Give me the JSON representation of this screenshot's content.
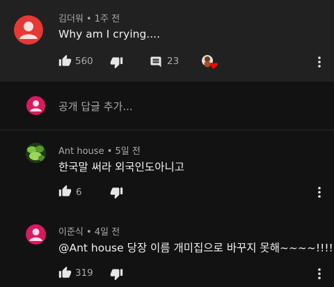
{
  "comments": [
    {
      "author": "김더워",
      "time": "1주 전",
      "text": "Why am I crying....",
      "likes": "560",
      "replies": "23"
    },
    {
      "author": "Ant house",
      "time": "5일 전",
      "text": "한국말 써라 외국인도아니고",
      "likes": "6"
    },
    {
      "author": "이준식",
      "time": "4일 전",
      "text": "@Ant house 당장 이름 개미집으로 바꾸지 못해~~~~!!!!",
      "likes": "319"
    }
  ],
  "add_comment": {
    "placeholder": "공개 답글 추가..."
  },
  "colors": {
    "background": "#121212",
    "highlight_card": "#212121",
    "avatar_red": "#e53935",
    "avatar_pink": "#d81b60",
    "heart": "#ff0000"
  }
}
